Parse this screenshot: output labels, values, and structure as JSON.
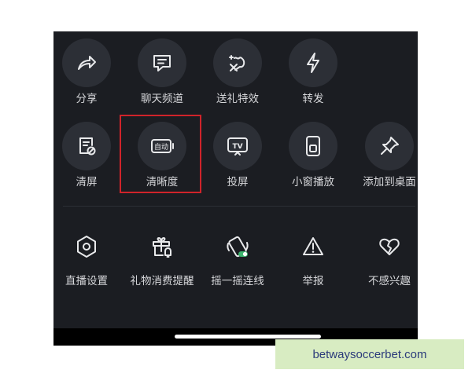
{
  "colors": {
    "panel_bg": "#1b1d22",
    "icon_circle_bg": "#2c2f36",
    "label_text": "#d6d7da",
    "highlight_border": "#d0232a",
    "watermark_bg": "#d8ecc2",
    "watermark_text": "#2a3a7a"
  },
  "row1": [
    {
      "label": "分享",
      "icon": "share-arrow-icon"
    },
    {
      "label": "聊天频道",
      "icon": "chat-channel-icon"
    },
    {
      "label": "送礼特效",
      "icon": "gift-effect-icon"
    },
    {
      "label": "转发",
      "icon": "lightning-forward-icon"
    }
  ],
  "row2": [
    {
      "label": "清屏",
      "icon": "clear-screen-icon"
    },
    {
      "label": "清晰度",
      "icon": "auto-quality-icon",
      "badge": "自动"
    },
    {
      "label": "投屏",
      "icon": "tv-cast-icon",
      "badge": "TV"
    },
    {
      "label": "小窗播放",
      "icon": "mini-window-icon"
    },
    {
      "label": "添加到桌面",
      "icon": "pin-icon"
    }
  ],
  "row3": [
    {
      "label": "直播设置",
      "icon": "hexagon-settings-icon"
    },
    {
      "label": "礼物消费提醒",
      "icon": "gift-bell-icon"
    },
    {
      "label": "摇一摇连线",
      "icon": "shake-phone-icon"
    },
    {
      "label": "举报",
      "icon": "warning-icon"
    },
    {
      "label": "不感兴趣",
      "icon": "broken-heart-icon"
    }
  ],
  "watermark": "betwaysoccerbet.com"
}
